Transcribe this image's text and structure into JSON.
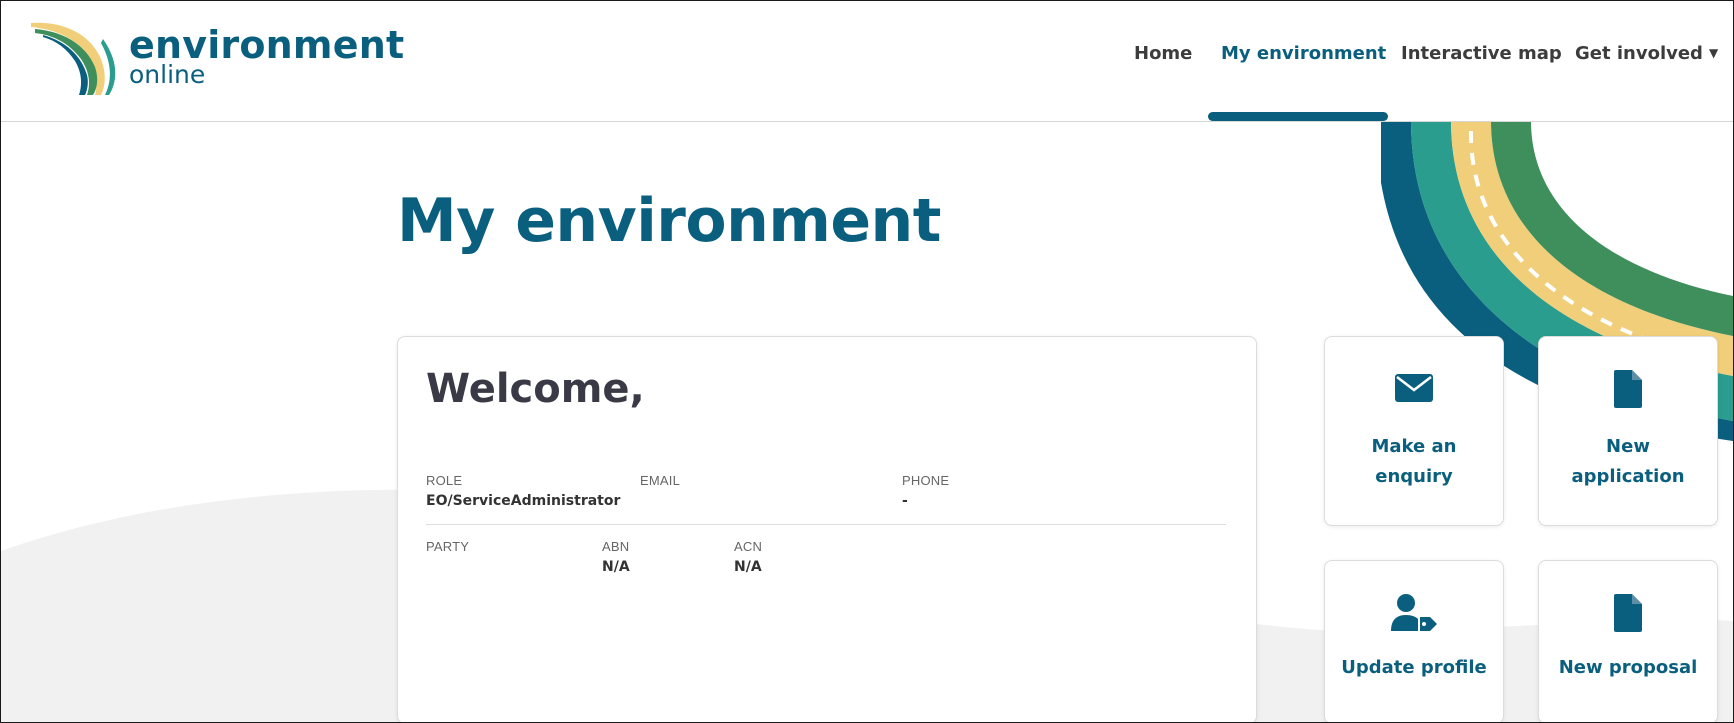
{
  "brand": {
    "name": "environment",
    "sub": "online",
    "colors": {
      "primary": "#0b5f7e",
      "teal": "#2a9d8f",
      "yellow": "#f1cf7a",
      "green": "#3e8f5c"
    }
  },
  "nav": {
    "items": [
      {
        "label": "Home",
        "active": false
      },
      {
        "label": "My environment",
        "active": true
      },
      {
        "label": "Interactive map",
        "active": false
      },
      {
        "label": "Get involved",
        "active": false,
        "dropdown": true
      }
    ]
  },
  "page": {
    "title": "My environment"
  },
  "welcome_card": {
    "greeting": "Welcome,",
    "role": {
      "label": "ROLE",
      "value": "EO/ServiceAdministrator"
    },
    "email": {
      "label": "EMAIL",
      "value": ""
    },
    "phone": {
      "label": "PHONE",
      "value": "-"
    },
    "party": {
      "label": "PARTY",
      "value": ""
    },
    "abn": {
      "label": "ABN",
      "value": "N/A"
    },
    "acn": {
      "label": "ACN",
      "value": "N/A"
    }
  },
  "tiles": [
    {
      "label": "Make an enquiry",
      "icon": "envelope-icon"
    },
    {
      "label": "New application",
      "icon": "document-icon"
    },
    {
      "label": "Update profile",
      "icon": "user-tag-icon"
    },
    {
      "label": "New proposal",
      "icon": "document-icon"
    }
  ]
}
